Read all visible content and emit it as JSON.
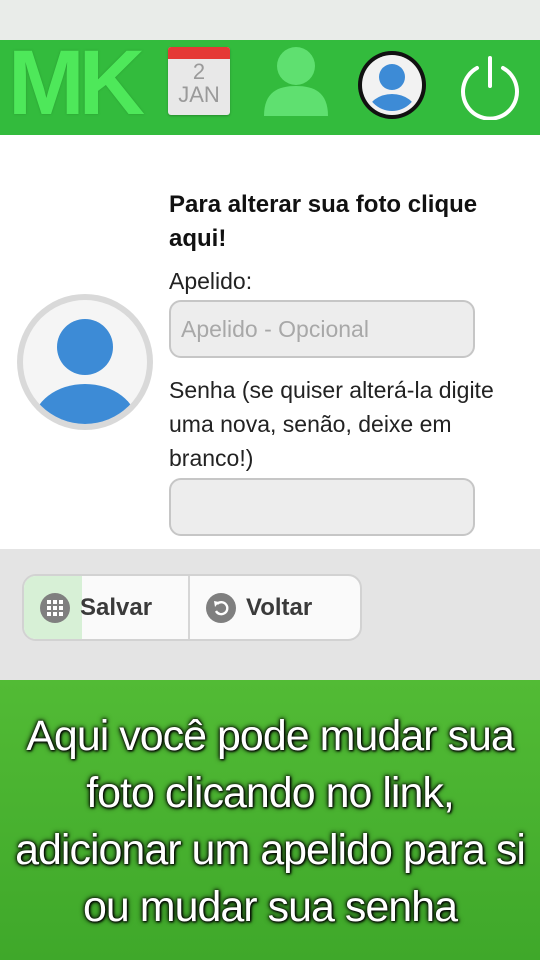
{
  "header": {
    "logo_text": "MK",
    "calendar": {
      "day": "2",
      "month": "JAN"
    },
    "icons": [
      "logo",
      "calendar-icon",
      "user-icon",
      "avatar-icon",
      "power-icon"
    ]
  },
  "form": {
    "title": "Para alterar sua foto clique aqui!",
    "nickname_label": "Apelido:",
    "nickname_placeholder": "Apelido - Opcional",
    "nickname_value": "",
    "password_label": "Senha (se quiser alterá-la digite uma nova, senão, deixe em branco!)",
    "password_value": ""
  },
  "actions": {
    "save_label": "Salvar",
    "back_label": "Voltar"
  },
  "caption": "Aqui você pode mudar sua foto clicando no link, adicionar um apelido para si ou mudar sua senha",
  "colors": {
    "header_green": "#33bb3d",
    "avatar_blue": "#3d8bd6",
    "footer_green": "#4cb532"
  }
}
